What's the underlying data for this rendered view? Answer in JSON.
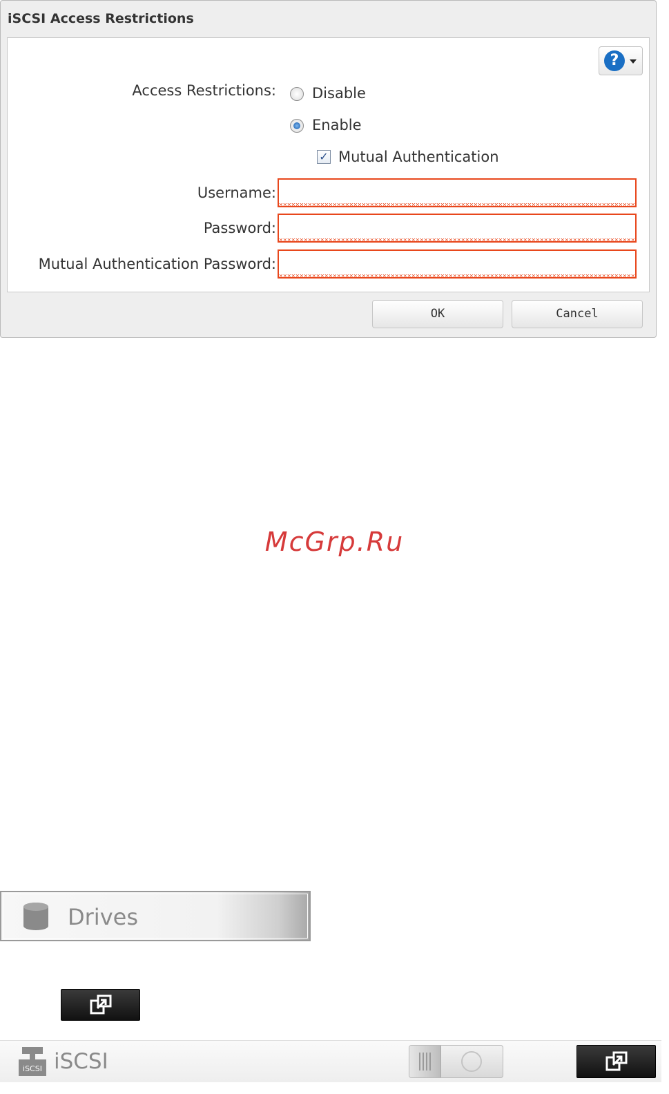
{
  "dialog": {
    "title": "iSCSI Access Restrictions",
    "help_icon": "help-question-icon",
    "access_restrictions_label": "Access Restrictions:",
    "option_disable": "Disable",
    "option_enable": "Enable",
    "selected_option": "Enable",
    "mutual_auth_label": "Mutual Authentication",
    "mutual_auth_checked": true,
    "username_label": "Username:",
    "username_value": "",
    "password_label": "Password:",
    "password_value": "",
    "mutual_password_label": "Mutual Authentication Password:",
    "mutual_password_value": "",
    "ok_label": "OK",
    "cancel_label": "Cancel",
    "error_color": "#e8471c",
    "radio_selected_color": "#1257a8"
  },
  "watermark": {
    "text": "McGrp.Ru",
    "color": "#d63a3a"
  },
  "drives_tile": {
    "label": "Drives",
    "icon": "database-icon"
  },
  "expand_button_icon": "external-link-icon",
  "iscsi_row": {
    "label": "iSCSI",
    "icon": "iscsi-server-icon",
    "toggle_state": "off"
  }
}
